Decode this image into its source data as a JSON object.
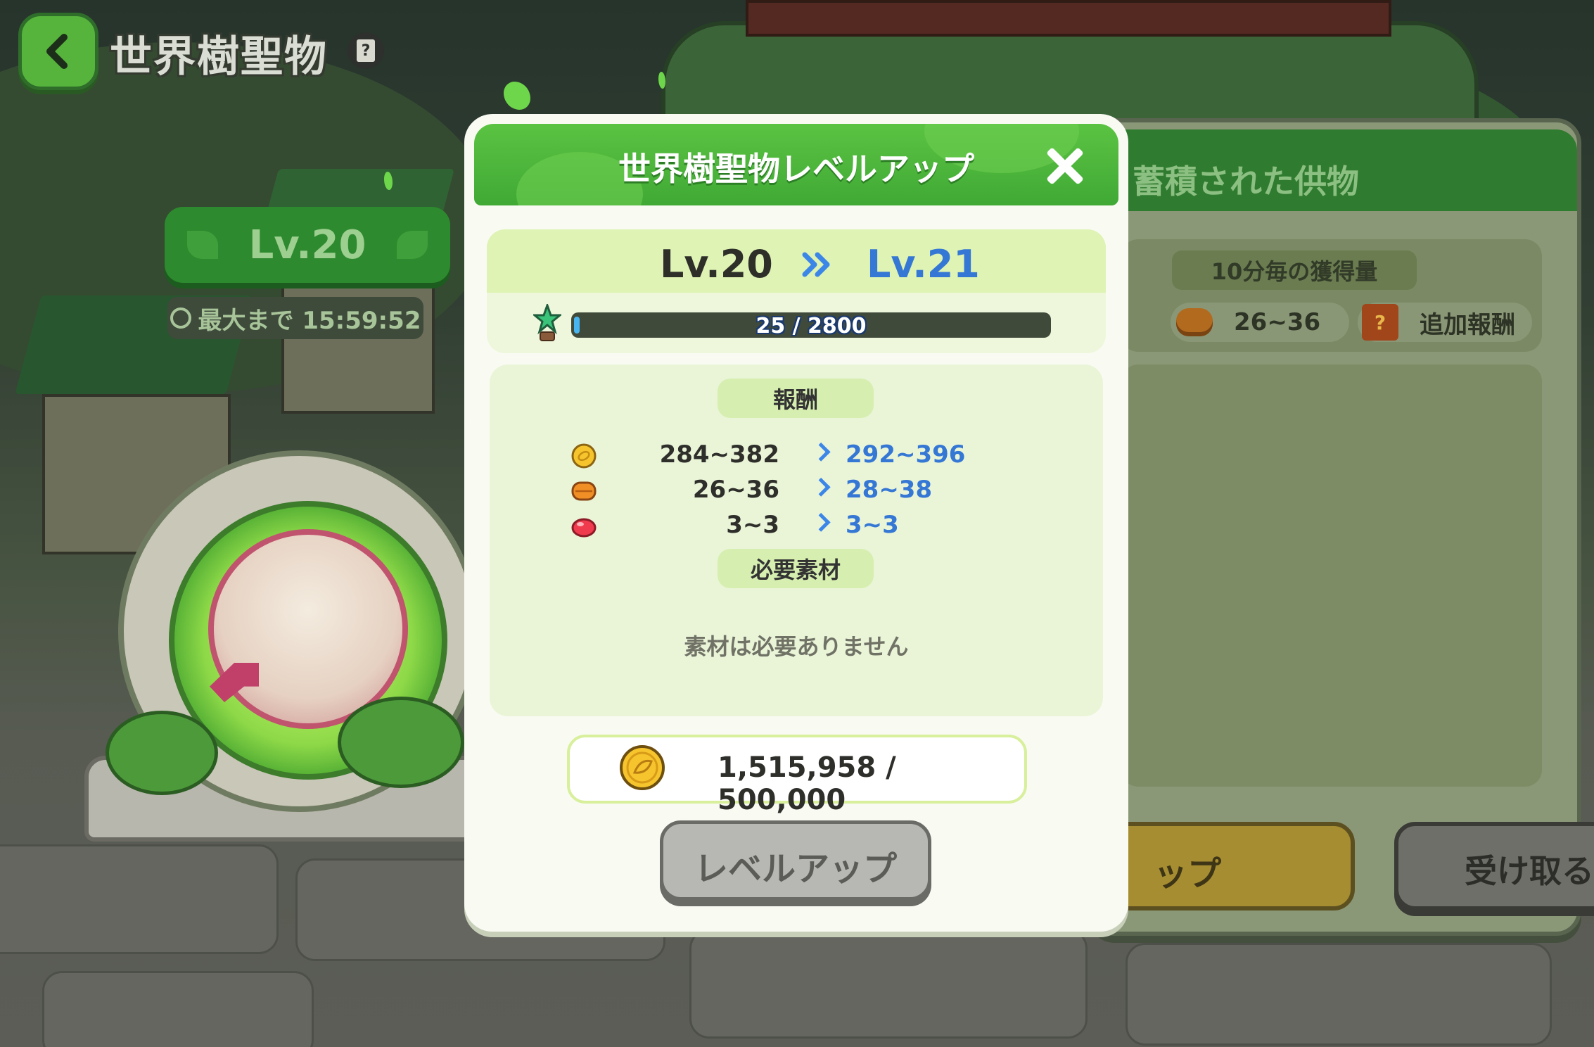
{
  "header": {
    "title": "世界樹聖物",
    "help_icon": "?"
  },
  "relic_status": {
    "level": "Lv.20",
    "timer": "最大まで 15:59:52"
  },
  "back_panel": {
    "title": "蓄積された供物",
    "rate_label": "10分毎の獲得量",
    "rate_value": "26~36",
    "bonus_label": "追加報酬",
    "levelup_partial": "ップ",
    "receive_label": "受け取る",
    "chest_icon": "?"
  },
  "modal": {
    "title": "世界樹聖物レベルアップ",
    "from_level": "Lv.20",
    "level_arrows": "»",
    "to_level": "Lv.21",
    "xp_text": "25 / 2800",
    "xp_fraction": 0.0089,
    "rewards_label": "報酬",
    "rewards": [
      {
        "icon": "gold-coin-icon",
        "old": "284~382",
        "new": "292~396"
      },
      {
        "icon": "pancake-icon",
        "old": "26~36",
        "new": "28~38"
      },
      {
        "icon": "red-jelly-icon",
        "old": "3~3",
        "new": "3~3"
      }
    ],
    "materials_label": "必要素材",
    "no_materials": "素材は必要ありません",
    "cost": "1,515,958 / 500,000",
    "levelup_button": "レベルアップ"
  },
  "colors": {
    "header_green": "#40a935",
    "accent_blue": "#3577d4",
    "modal_bg": "#f9fbf3"
  }
}
